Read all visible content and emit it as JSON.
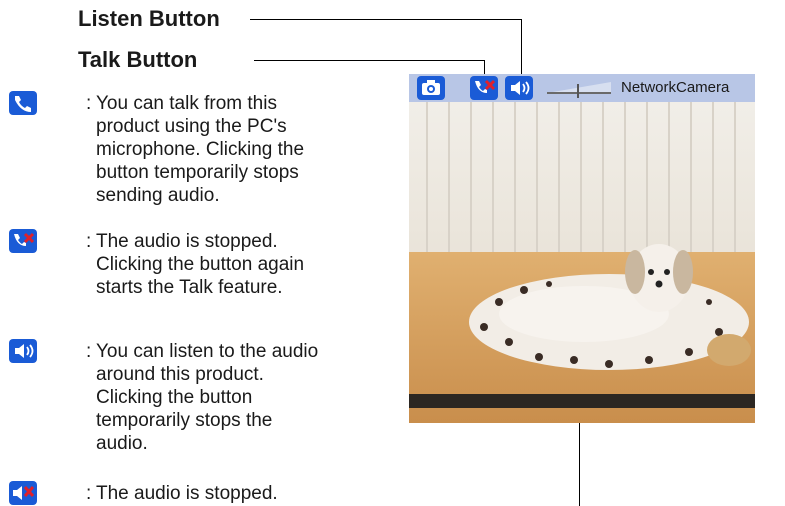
{
  "callouts": {
    "listen": "Listen Button",
    "talk": "Talk Button"
  },
  "items": [
    {
      "icon": "talk-on-icon",
      "lines": [
        "You can talk from this",
        "product using the PC's",
        "microphone. Clicking the",
        "button temporarily stops",
        "sending audio."
      ]
    },
    {
      "icon": "talk-stopped-icon",
      "lines": [
        "The audio is stopped.",
        "Clicking the button again",
        "starts the Talk feature."
      ]
    },
    {
      "icon": "listen-on-icon",
      "lines": [
        "You can listen to the audio",
        "around this product.",
        "Clicking the button",
        "temporarily stops the",
        "audio."
      ]
    },
    {
      "icon": "listen-stopped-icon",
      "lines": [
        "The audio is stopped."
      ]
    }
  ],
  "colon": ":",
  "viewer": {
    "title": "NetworkCamera",
    "buttons": [
      "camera-icon",
      "talk-stopped-icon",
      "speaker-icon",
      "volume-slider"
    ]
  },
  "colors": {
    "button_blue": "#1a5bd6",
    "toolbar": "#b8c6e6",
    "stop_red": "#e0202a"
  }
}
